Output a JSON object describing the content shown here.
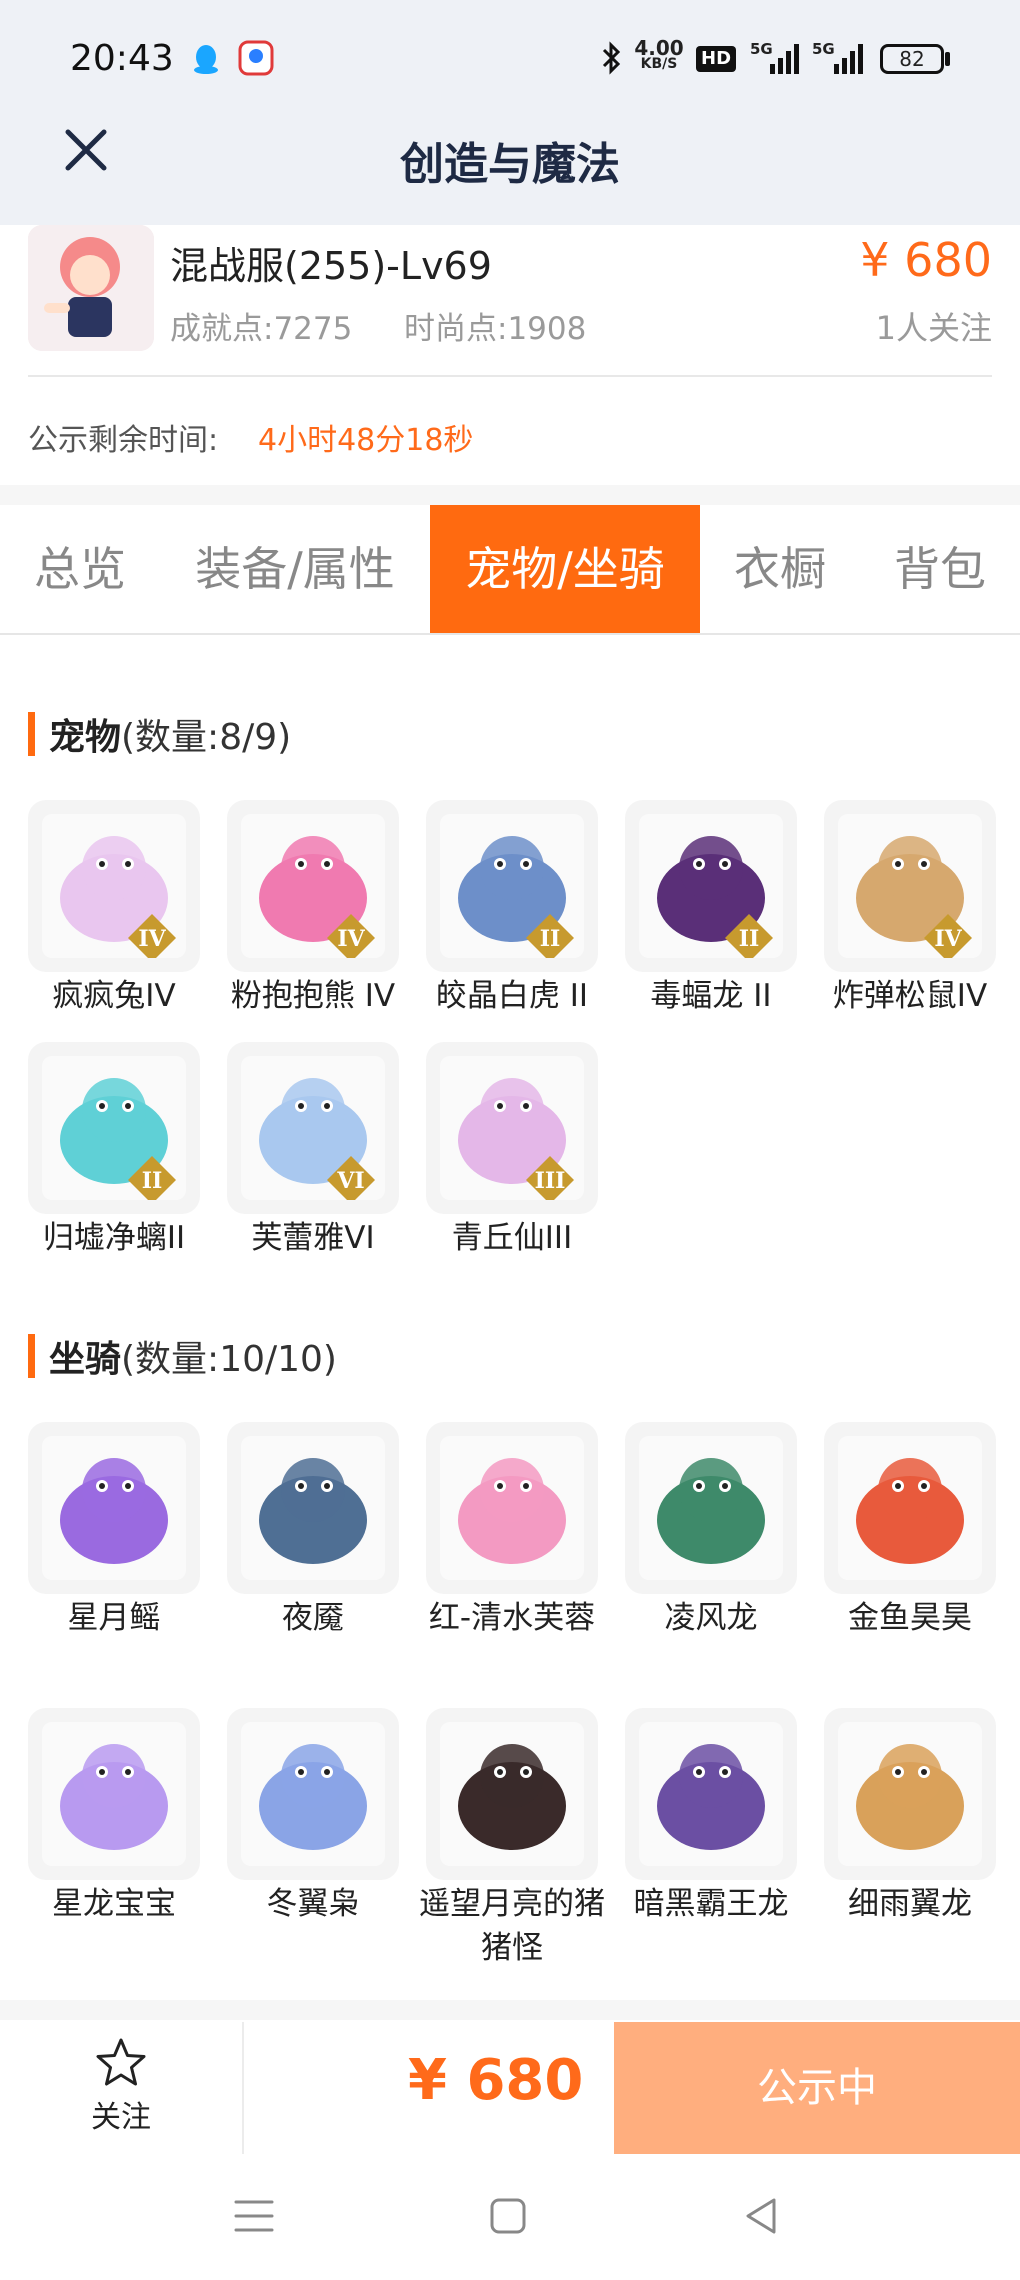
{
  "status_bar": {
    "time": "20:43",
    "net_speed_value": "4.00",
    "net_speed_unit": "KB/S",
    "hd_badge": "HD",
    "signal1": "5G",
    "signal2": "5G",
    "battery": "82"
  },
  "header": {
    "title": "创造与魔法",
    "close_icon": "close-icon"
  },
  "role": {
    "name": "混战服(255)-Lv69",
    "achievement": "成就点:7275",
    "fashion": "时尚点:1908",
    "price": "¥ 680",
    "followers": "1人关注",
    "notice_label": "公示剩余时间:",
    "notice_time": "4小时48分18秒"
  },
  "tabs": [
    {
      "label": "总览",
      "active": false
    },
    {
      "label": "装备/属性",
      "active": false
    },
    {
      "label": "宠物/坐骑",
      "active": true
    },
    {
      "label": "衣橱",
      "active": false
    },
    {
      "label": "背包",
      "active": false
    }
  ],
  "pets": {
    "title": "宠物",
    "count": "(数量:8/9)",
    "items": [
      {
        "name": "疯疯兔IV",
        "color": "#e9c6ef",
        "grade": "IV"
      },
      {
        "name": "粉抱抱熊 IV",
        "color": "#f07ab0",
        "grade": "IV"
      },
      {
        "name": "皎晶白虎 II",
        "color": "#6d8fc9",
        "grade": "II"
      },
      {
        "name": "毒蝠龙 II",
        "color": "#5a2f78",
        "grade": "II"
      },
      {
        "name": "炸弹松鼠IV",
        "color": "#d6a86e",
        "grade": "IV"
      },
      {
        "name": "归墟净螭II",
        "color": "#5fd0d6",
        "grade": "II"
      },
      {
        "name": "芙蕾雅VI",
        "color": "#a9c8ef",
        "grade": "VI"
      },
      {
        "name": "青丘仙III",
        "color": "#e4b7e8",
        "grade": "III"
      }
    ]
  },
  "mounts": {
    "title": "坐骑",
    "count": "(数量:10/10)",
    "items": [
      {
        "name": "星月鳐",
        "color": "#9a6ae0"
      },
      {
        "name": "夜魇",
        "color": "#4f6f94"
      },
      {
        "name": "红-清水芙蓉",
        "color": "#f39ac2"
      },
      {
        "name": "凌风龙",
        "color": "#3e8a6a"
      },
      {
        "name": "金鱼昊昊",
        "color": "#e85a3c"
      },
      {
        "name": "星龙宝宝",
        "color": "#b89af0"
      },
      {
        "name": "冬翼枭",
        "color": "#8aa4e6"
      },
      {
        "name": "遥望月亮的猪猪怪",
        "color": "#3a2a2a"
      },
      {
        "name": "暗黑霸王龙",
        "color": "#6b4fa3"
      },
      {
        "name": "细雨翼龙",
        "color": "#d9a15a"
      }
    ]
  },
  "bottom": {
    "follow_label": "关注",
    "price": "¥ 680",
    "status": "公示中"
  },
  "accent": "#ff6a10"
}
